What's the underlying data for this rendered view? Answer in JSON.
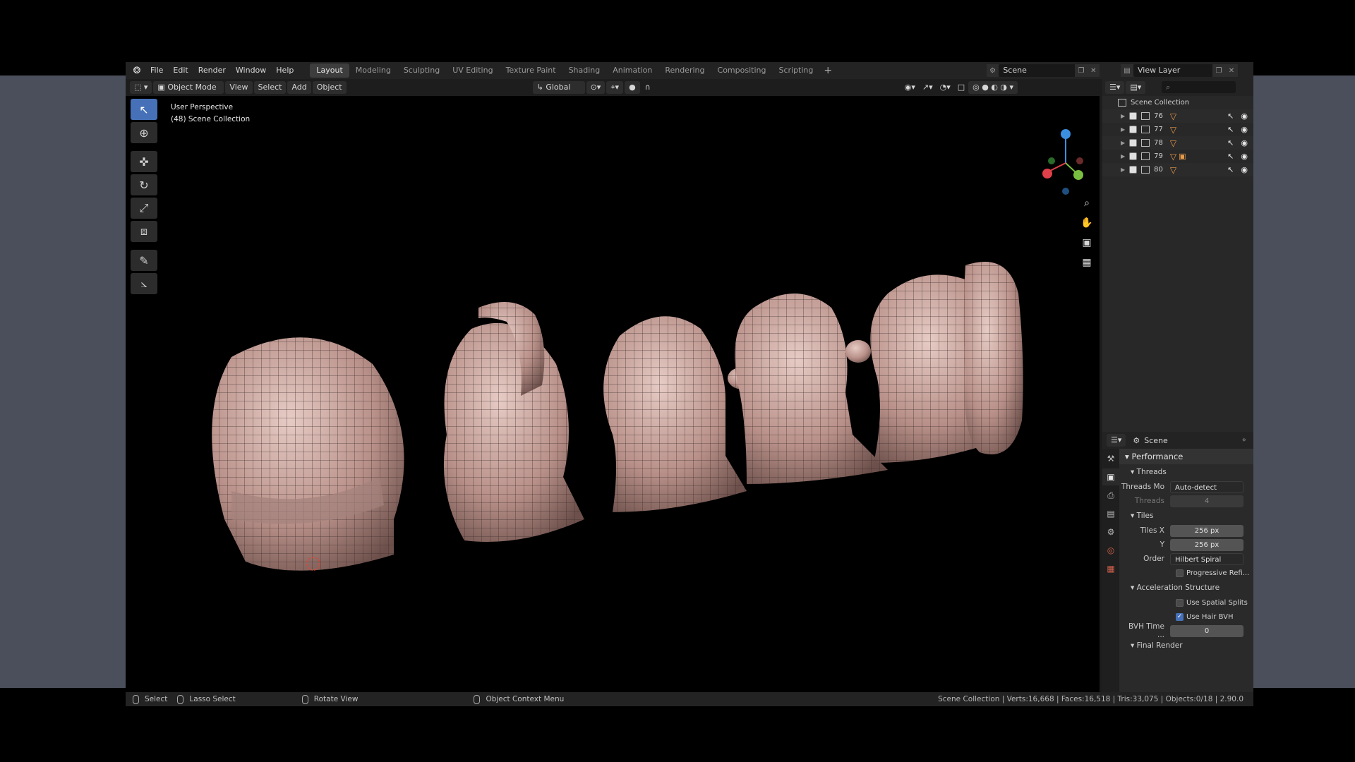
{
  "topbar": {
    "menus": [
      "File",
      "Edit",
      "Render",
      "Window",
      "Help"
    ],
    "workspaces": [
      "Layout",
      "Modeling",
      "Sculpting",
      "UV Editing",
      "Texture Paint",
      "Shading",
      "Animation",
      "Rendering",
      "Compositing",
      "Scripting"
    ],
    "active_workspace": "Layout",
    "add_workspace": "+",
    "scene_name": "Scene",
    "view_layer_name": "View Layer"
  },
  "viewport_header": {
    "mode": "Object Mode",
    "menus": [
      "View",
      "Select",
      "Add",
      "Object"
    ],
    "transform_orientation": "Global"
  },
  "viewport": {
    "perspective_label": "User Perspective",
    "collection_label": "(48) Scene Collection",
    "gizmo_axes": {
      "x_color": "#e0404a",
      "y_color": "#7ac040",
      "z_color": "#3b8fe0"
    }
  },
  "outliner": {
    "root": "Scene Collection",
    "items": [
      {
        "name": "76",
        "has_camera": false
      },
      {
        "name": "77",
        "has_camera": false
      },
      {
        "name": "78",
        "has_camera": false
      },
      {
        "name": "79",
        "has_camera": true
      },
      {
        "name": "80",
        "has_camera": false
      }
    ]
  },
  "properties": {
    "context": "Scene",
    "panel": "Performance",
    "threads": {
      "title": "Threads",
      "mode_label": "Threads Mo",
      "mode_value": "Auto-detect",
      "count_label": "Threads",
      "count_value": "4"
    },
    "tiles": {
      "title": "Tiles",
      "x_label": "Tiles X",
      "x_value": "256 px",
      "y_label": "Y",
      "y_value": "256 px",
      "order_label": "Order",
      "order_value": "Hilbert Spiral",
      "progressive_label": "Progressive Refi..."
    },
    "accel": {
      "title": "Acceleration Structure",
      "spatial_label": "Use Spatial Splits",
      "spatial_checked": false,
      "hair_label": "Use Hair BVH",
      "hair_checked": true,
      "bvh_label": "BVH Time ...",
      "bvh_value": "0"
    },
    "final_render": "Final Render"
  },
  "statusbar": {
    "select": "Select",
    "lasso": "Lasso Select",
    "rotate": "Rotate View",
    "context_menu": "Object Context Menu",
    "stats": "Scene Collection | Verts:16,668 | Faces:16,518 | Tris:33,075 | Objects:0/18 | 2.90.0"
  },
  "colors": {
    "accent": "#4671b8",
    "object_orange": "#e89b4a",
    "mesh_skin": "#c9a9a2"
  }
}
